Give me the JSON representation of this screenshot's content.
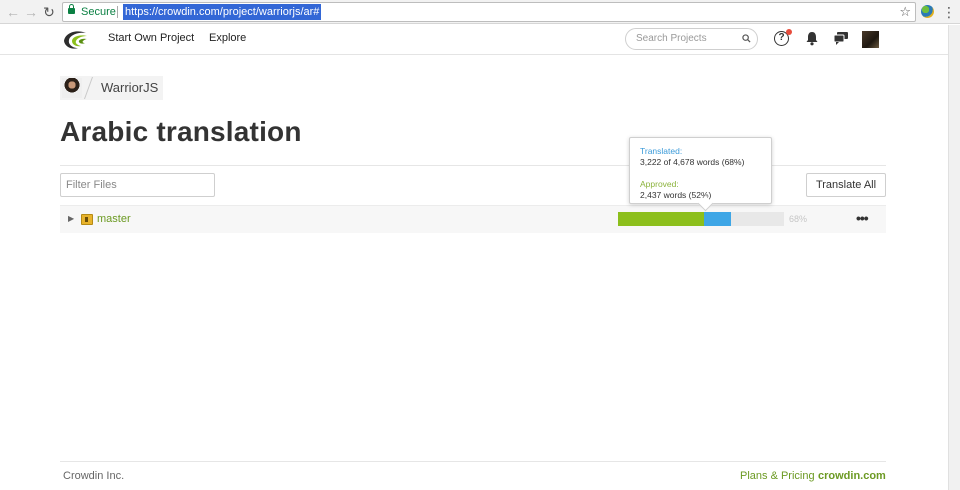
{
  "browser": {
    "secure_label": "Secure",
    "url": "https://crowdin.com/project/warriorjs/ar#"
  },
  "header": {
    "nav": [
      "Start Own Project",
      "Explore"
    ],
    "search_placeholder": "Search Projects"
  },
  "breadcrumb": {
    "project": "WarriorJS"
  },
  "page": {
    "title": "Arabic translation",
    "filter_placeholder": "Filter Files",
    "translate_all_label": "Translate All"
  },
  "files": [
    {
      "name": "master",
      "translated_percent": 68,
      "approved_percent": 52,
      "percent_label": "68%"
    }
  ],
  "tooltip": {
    "translated_label": "Translated:",
    "translated_value": "3,222 of 4,678 words (68%)",
    "approved_label": "Approved:",
    "approved_value": "2,437 words (52%)"
  },
  "footer": {
    "company": "Crowdin Inc.",
    "plans_link": "Plans & Pricing",
    "brand_link": "crowdin.com"
  },
  "colors": {
    "brand_green": "#6c9a23",
    "approved": "#8cbf1c",
    "translated": "#3ea6e6"
  }
}
